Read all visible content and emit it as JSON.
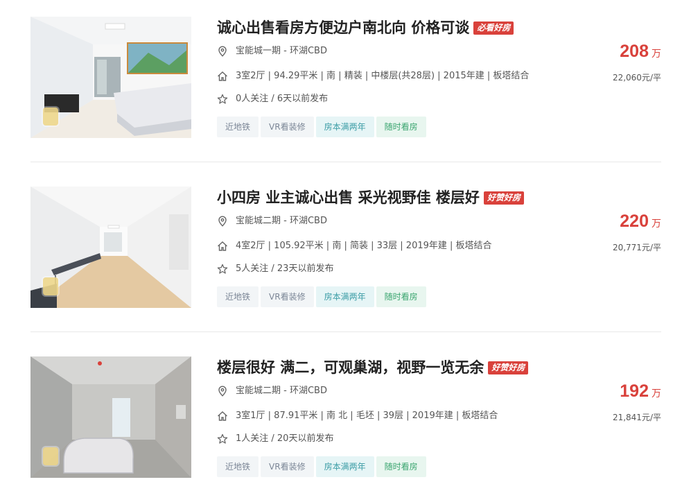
{
  "listings": [
    {
      "title": "诚心出售看房方便边户南北向 价格可谈",
      "badge": "必看好房",
      "location": "宝能城一期 - 环湖CBD",
      "house_info": "3室2厅 | 94.29平米 | 南 | 精装 | 中楼层(共28层) | 2015年建 | 板塔结合",
      "follow_info": "0人关注 / 6天以前发布",
      "tags": [
        "近地铁",
        "VR看装修",
        "房本满两年",
        "随时看房"
      ],
      "total_price": "208",
      "total_unit": "万",
      "unit_price": "22,060元/平"
    },
    {
      "title": "小四房 业主诚心出售 采光视野佳 楼层好",
      "badge": "好赞好房",
      "location": "宝能城二期 - 环湖CBD",
      "house_info": "4室2厅 | 105.92平米 | 南 | 简装 | 33层 | 2019年建 | 板塔结合",
      "follow_info": "5人关注 / 23天以前发布",
      "tags": [
        "近地铁",
        "VR看装修",
        "房本满两年",
        "随时看房"
      ],
      "total_price": "220",
      "total_unit": "万",
      "unit_price": "20,771元/平"
    },
    {
      "title": "楼层很好 满二，可观巢湖，视野一览无余",
      "badge": "好赞好房",
      "location": "宝能城二期 - 环湖CBD",
      "house_info": "3室1厅 | 87.91平米 | 南 北 | 毛坯 | 39层 | 2019年建 | 板塔结合",
      "follow_info": "1人关注 / 20天以前发布",
      "tags": [
        "近地铁",
        "VR看装修",
        "房本满两年",
        "随时看房"
      ],
      "total_price": "192",
      "total_unit": "万",
      "unit_price": "21,841元/平"
    }
  ],
  "colors": {
    "price": "#d9413b",
    "badge_bg": "#d9413b",
    "tag_gray": "#7b8696",
    "tag_teal": "#3a9ca5",
    "tag_green": "#3aa56f"
  },
  "icons": [
    "location-pin-icon",
    "house-icon",
    "star-icon"
  ]
}
